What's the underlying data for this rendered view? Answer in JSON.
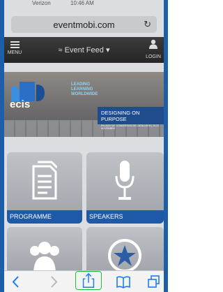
{
  "status": {
    "carrier": "Verizon",
    "time": "10:46 AM"
  },
  "browser": {
    "url": "eventmobi.com",
    "reload_icon": "reload-icon"
  },
  "header": {
    "menu_label": "MENU",
    "feed_label": "Event Feed",
    "login_label": "LOGIN"
  },
  "banner": {
    "logo_text": "ecis",
    "tagline": [
      "LEADING",
      "LEARNING",
      "WORLDWIDE"
    ],
    "title": "DESIGNING ON PURPOSE",
    "subtitle": "PALACIO DE CONGRESOS DE CATALUNYA | 19-21 NOVEMBER"
  },
  "tiles": [
    {
      "label": "PROGRAMME",
      "icon": "document-icon"
    },
    {
      "label": "SPEAKERS",
      "icon": "microphone-icon"
    },
    {
      "label": "",
      "icon": "people-icon"
    },
    {
      "label": "",
      "icon": "award-icon"
    }
  ],
  "toolbar": {
    "icons": [
      "back-icon",
      "forward-icon",
      "share-icon",
      "bookmarks-icon",
      "tabs-icon"
    ]
  },
  "colors": {
    "frame": "#1d5ea8",
    "tile_label": "#1e5aa7",
    "banner_accent": "#8fd3f1",
    "highlight": "#1fbf3a"
  }
}
